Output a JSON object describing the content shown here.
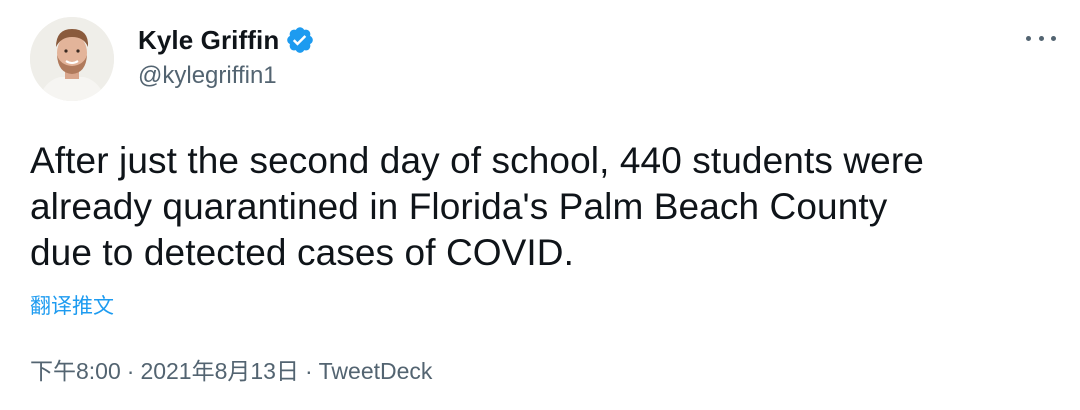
{
  "author": {
    "name": "Kyle Griffin",
    "handle": "@kylegriffin1",
    "verified": true
  },
  "tweet": {
    "text_lines": [
      "After just the second day of school, 440 students were",
      "already quarantined in Florida's Palm Beach County",
      "due to detected cases of COVID."
    ],
    "translate_label": "翻译推文"
  },
  "meta": {
    "time": "下午8:00",
    "separator": "·",
    "date": "2021年8月13日",
    "client": "TweetDeck"
  },
  "colors": {
    "accent": "#1d9bf0",
    "text": "#0f1419",
    "secondary": "#536471"
  },
  "icons": {
    "verified": "verified-badge-icon",
    "more": "more-options-icon"
  }
}
